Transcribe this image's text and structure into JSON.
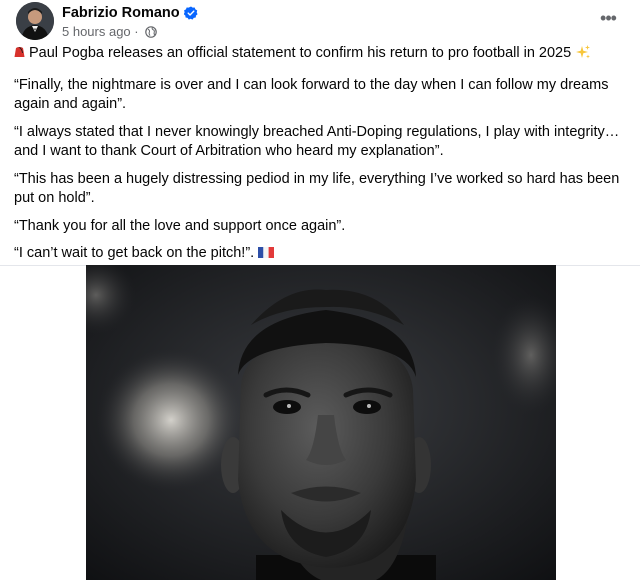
{
  "post": {
    "author": "Fabrizio Romano",
    "verified": true,
    "timestamp": "5 hours ago",
    "audience_icon": "globe-icon",
    "more_label": "•••",
    "paragraphs": [
      "Paul Pogba releases an official statement to confirm his return to pro football in 2025",
      "“Finally, the nightmare is over and I can look forward to the day when I can follow my dreams again and again”.",
      "“I always stated that I never knowingly breached Anti-Doping regulations, I play with integrity… and I want to thank Court of Arbitration who heard my explanation”.",
      "“This has been a hugely distressing pediod in my life, everything I’ve worked so hard has been put on hold”.",
      "“Thank you for all the love and support once again”.",
      "“I can’t wait to get back on the pitch!”."
    ],
    "media_alt": "Portrait photo of Paul Pogba looking upward"
  },
  "colors": {
    "text": "#050505",
    "secondary": "#65676b",
    "verified_blue": "#0866ff",
    "divider": "#e4e6eb"
  }
}
